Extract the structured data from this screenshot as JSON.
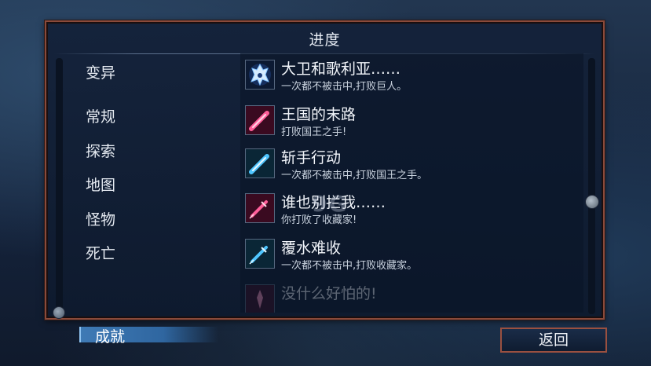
{
  "dialog": {
    "title": "进度"
  },
  "sidebar": {
    "items": [
      {
        "label": "变异"
      },
      {
        "label": "常规"
      },
      {
        "label": "探索"
      },
      {
        "label": "地图"
      },
      {
        "label": "怪物"
      },
      {
        "label": "死亡"
      },
      {
        "label": "成就",
        "active": true
      }
    ]
  },
  "achievements": [
    {
      "title": "大卫和歌利亚……",
      "desc": "一次都不被击中,打败巨人。",
      "icon": "giant-crest-icon",
      "color": "#6fb6ff"
    },
    {
      "title": "王国的末路",
      "desc": "打败国王之手!",
      "icon": "pink-sword-icon",
      "color": "#ff4f8e"
    },
    {
      "title": "斩手行动",
      "desc": "一次都不被击中,打败国王之手。",
      "icon": "cyan-sword-icon",
      "color": "#6fd4ff"
    },
    {
      "title": "谁也别拦我……",
      "desc": "你打败了收藏家!",
      "icon": "pink-syringe-icon",
      "color": "#ff4f8e"
    },
    {
      "title": "覆水难收",
      "desc": "一次都不被击中,打败收藏家。",
      "icon": "cyan-syringe-icon",
      "color": "#6fd4ff"
    },
    {
      "title": "没什么好怕的!",
      "desc": "",
      "icon": "faded-icon",
      "color": "#ff4f8e"
    }
  ],
  "buttons": {
    "back": "返回"
  },
  "watermark": "9G"
}
